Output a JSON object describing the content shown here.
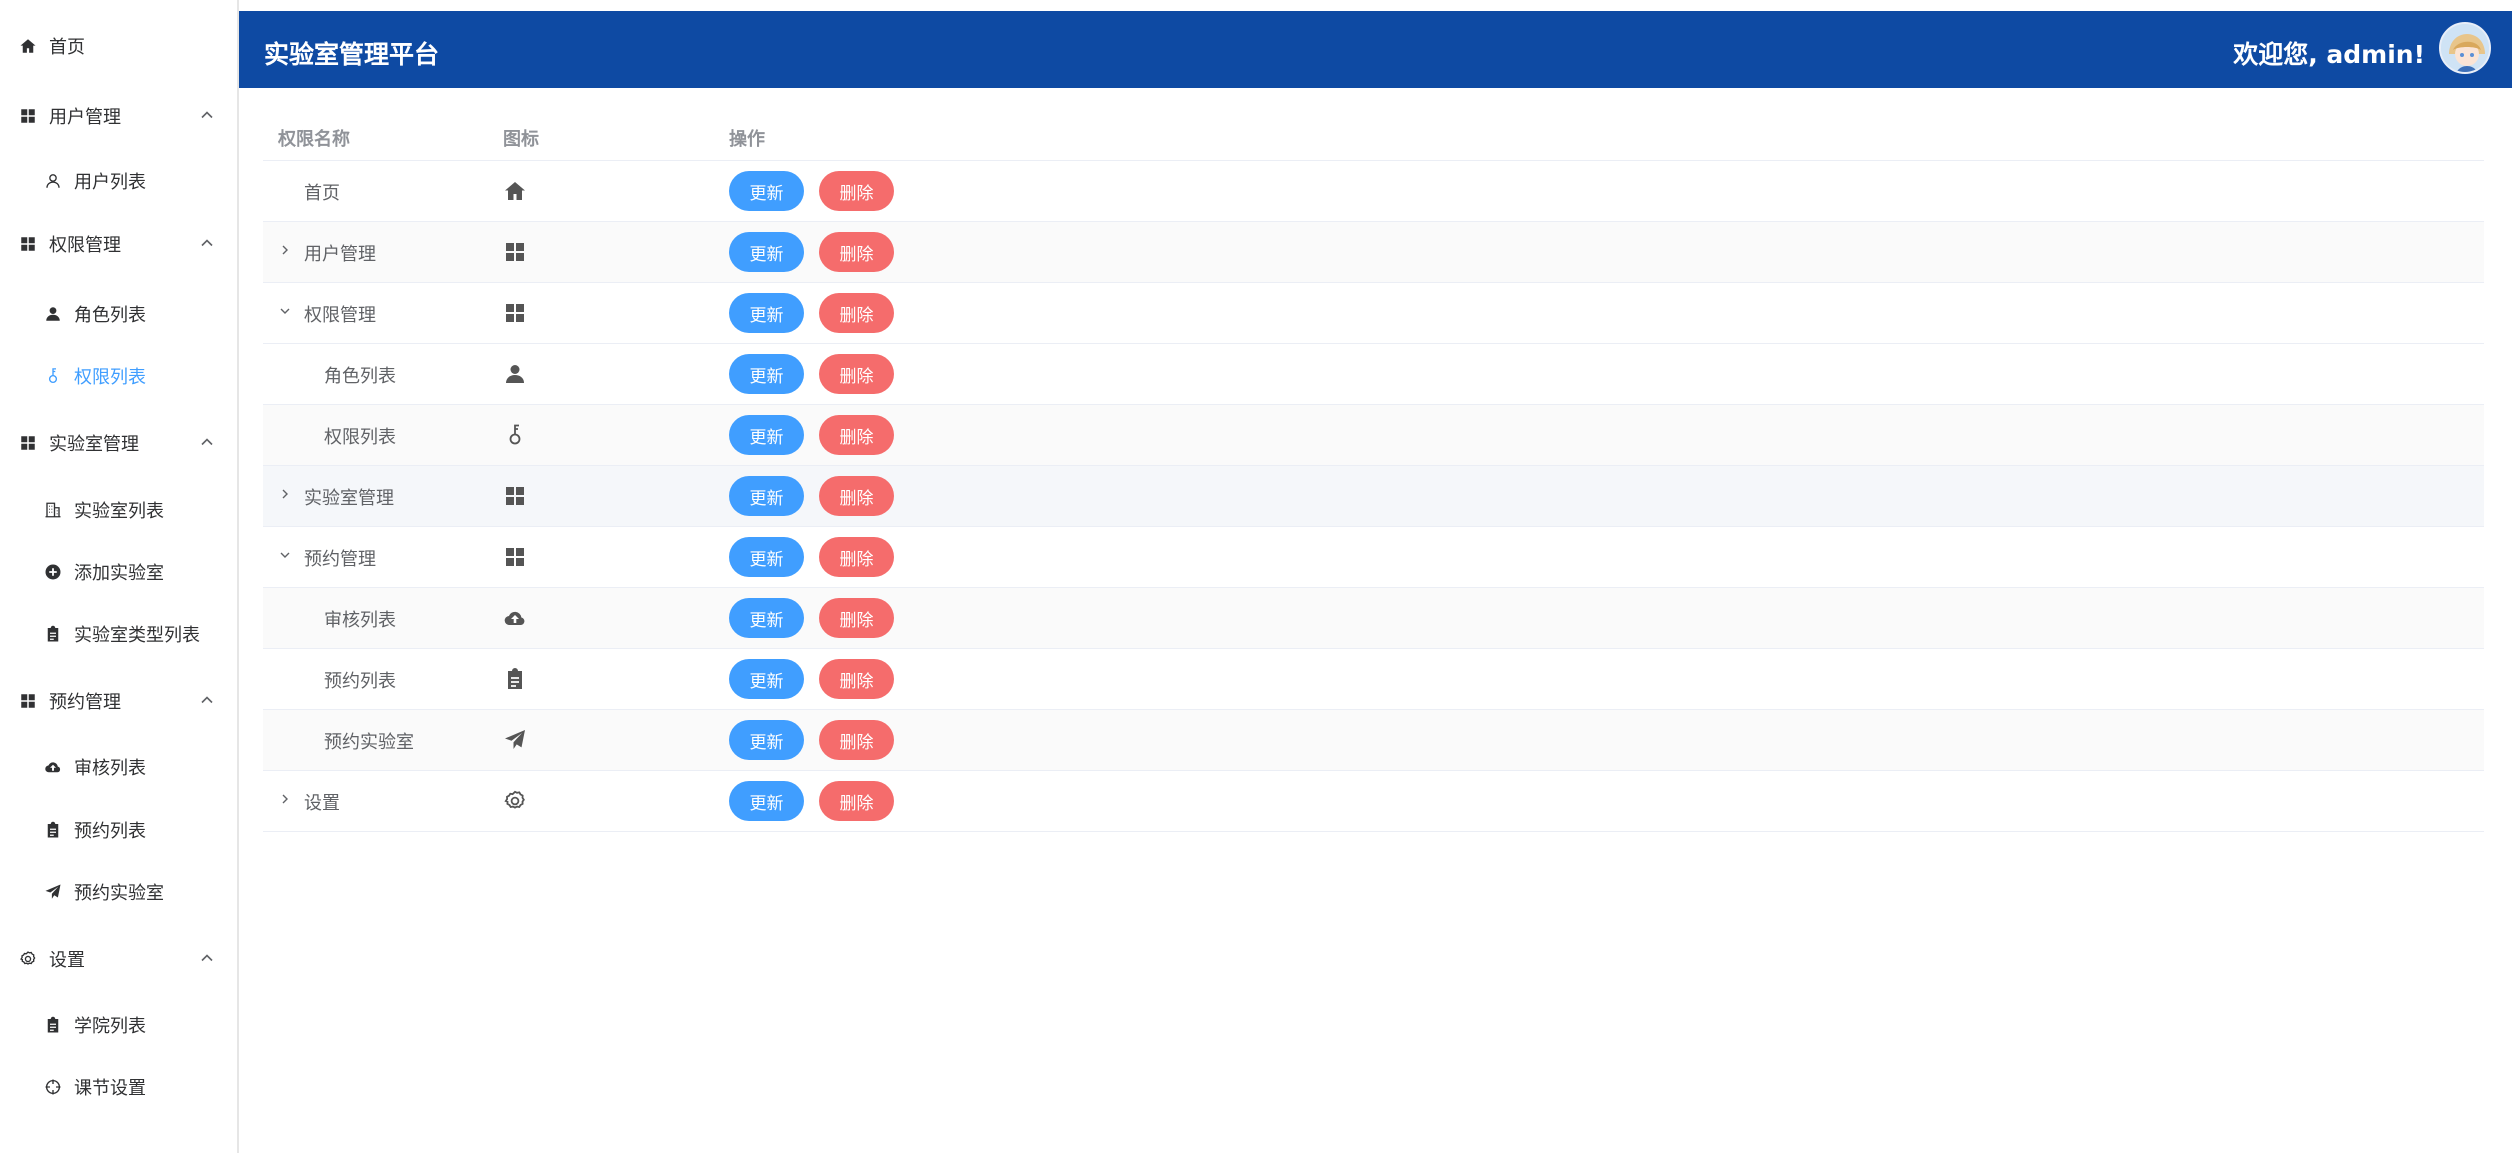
{
  "header": {
    "title": "实验室管理平台",
    "welcome": "欢迎您, admin!"
  },
  "sidebar": {
    "items": [
      {
        "label": "首页",
        "icon": "home-icon"
      },
      {
        "label": "用户管理",
        "icon": "grid-icon"
      },
      {
        "label": "用户列表",
        "icon": "user-outline-icon"
      },
      {
        "label": "权限管理",
        "icon": "grid-icon"
      },
      {
        "label": "角色列表",
        "icon": "user-icon"
      },
      {
        "label": "权限列表",
        "icon": "key-icon"
      },
      {
        "label": "实验室管理",
        "icon": "grid-icon"
      },
      {
        "label": "实验室列表",
        "icon": "building-icon"
      },
      {
        "label": "添加实验室",
        "icon": "plus-circle-icon"
      },
      {
        "label": "实验室类型列表",
        "icon": "clipboard-icon"
      },
      {
        "label": "预约管理",
        "icon": "grid-icon"
      },
      {
        "label": "审核列表",
        "icon": "cloud-upload-icon"
      },
      {
        "label": "预约列表",
        "icon": "clipboard-icon"
      },
      {
        "label": "预约实验室",
        "icon": "send-icon"
      },
      {
        "label": "设置",
        "icon": "gear-icon"
      },
      {
        "label": "学院列表",
        "icon": "clipboard-icon"
      },
      {
        "label": "课节设置",
        "icon": "crosshair-icon"
      }
    ],
    "active": "权限列表"
  },
  "table": {
    "columns": [
      "权限名称",
      "图标",
      "操作"
    ],
    "rows": [
      {
        "name": "首页",
        "icon": "home-icon"
      },
      {
        "name": "用户管理",
        "icon": "grid-icon"
      },
      {
        "name": "权限管理",
        "icon": "grid-icon"
      },
      {
        "name": "角色列表",
        "icon": "user-icon"
      },
      {
        "name": "权限列表",
        "icon": "key-icon"
      },
      {
        "name": "实验室管理",
        "icon": "grid-icon"
      },
      {
        "name": "预约管理",
        "icon": "grid-icon"
      },
      {
        "name": "审核列表",
        "icon": "cloud-upload-icon"
      },
      {
        "name": "预约列表",
        "icon": "clipboard-icon"
      },
      {
        "name": "预约实验室",
        "icon": "send-icon"
      },
      {
        "name": "设置",
        "icon": "gear-icon"
      }
    ],
    "update_label": "更新",
    "delete_label": "删除"
  },
  "colors": {
    "header_bg": "#0e4aa3",
    "primary": "#409eff",
    "danger": "#f56c6c"
  }
}
